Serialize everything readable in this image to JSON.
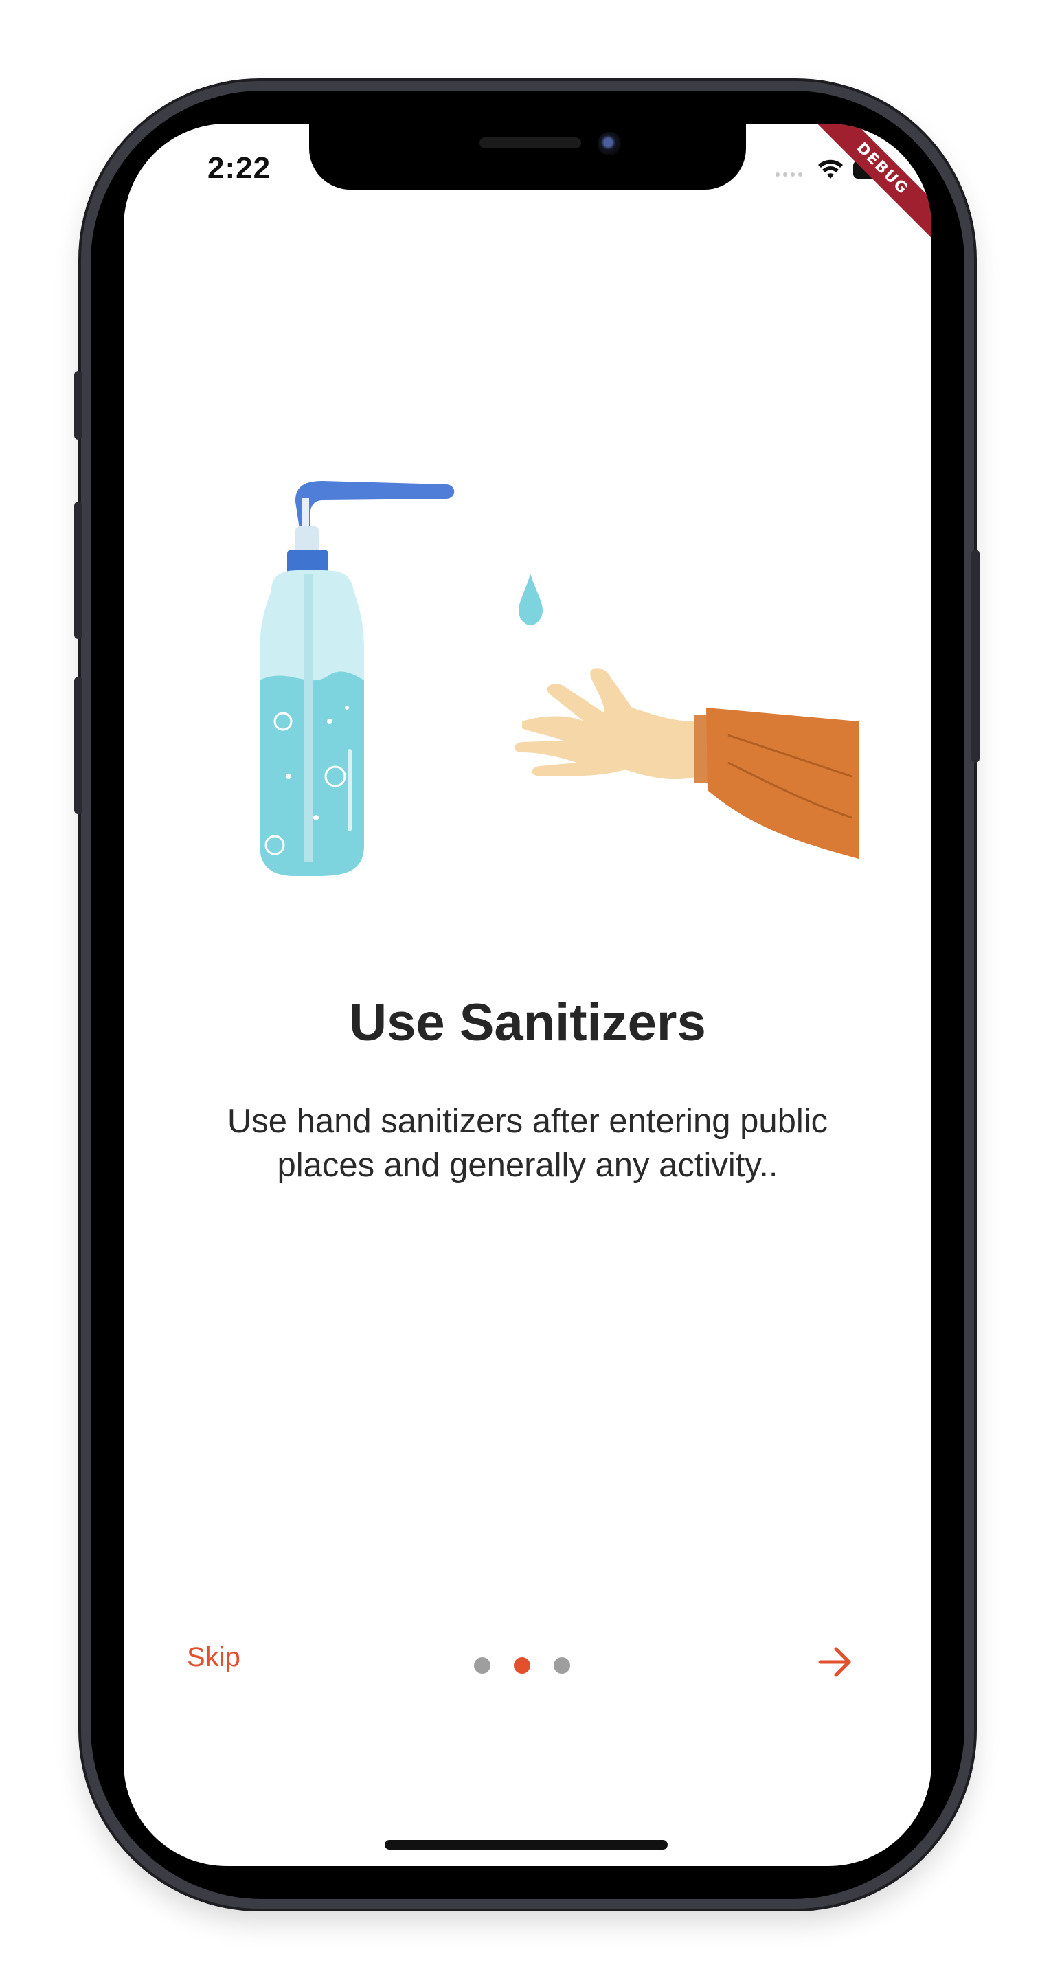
{
  "status_bar": {
    "time": "2:22",
    "icons": [
      "cellular-signal-icon",
      "wifi-icon",
      "battery-icon"
    ]
  },
  "debug_banner": {
    "label": "DEBUG"
  },
  "onboarding": {
    "illustration_icon": "hand-sanitizer-illustration",
    "title": "Use Sanitizers",
    "description": "Use hand sanitizers after entering public places and generally any activity..",
    "page_indicator": {
      "total": 3,
      "current": 2
    }
  },
  "footer": {
    "skip_label": "Skip",
    "next_icon": "arrow-right-icon"
  },
  "colors": {
    "accent": "#e2502d",
    "inactive_dot": "#9e9e9e",
    "text": "#262626",
    "debug_banner": "#a1202f"
  }
}
